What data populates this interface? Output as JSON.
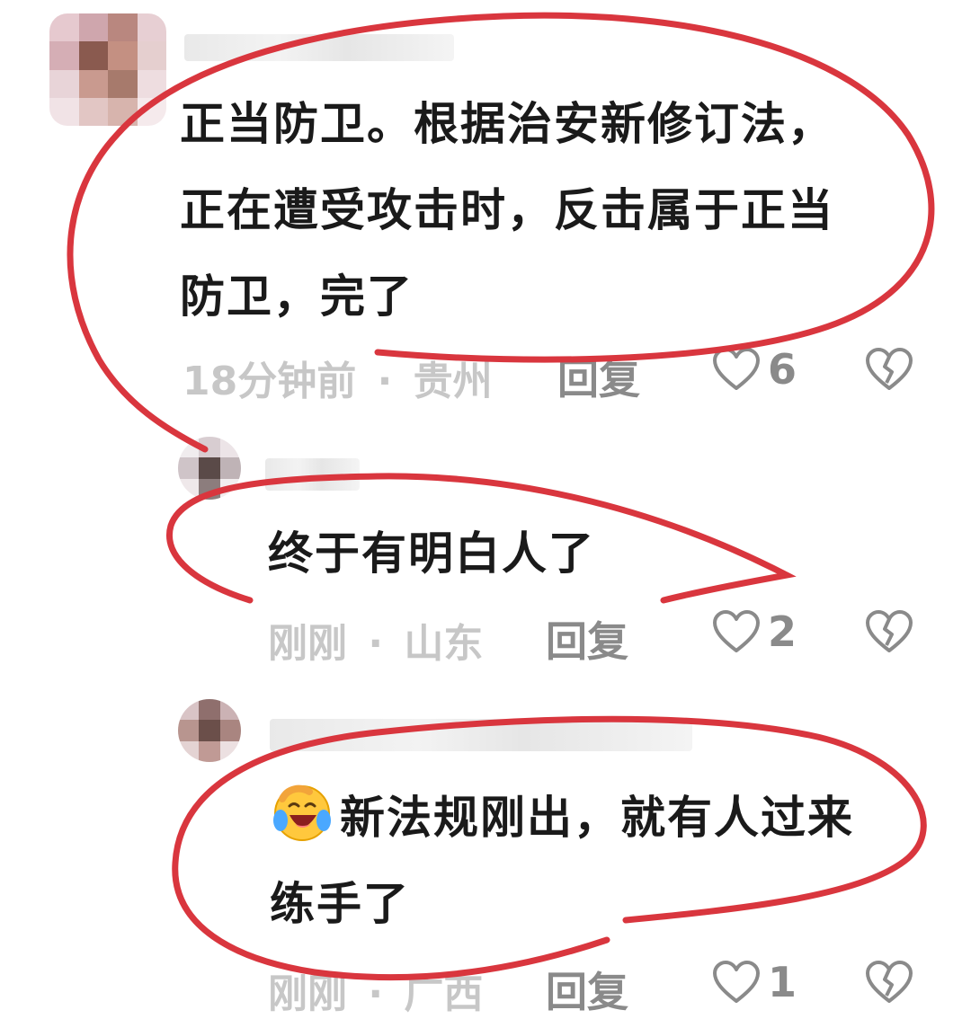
{
  "comments": [
    {
      "avatar_colors": [
        "#e6c9cf",
        "#cfa6ad",
        "#b9877f",
        "#e7cfd3",
        "#d5aeb5",
        "#8a5a4f",
        "#c49082",
        "#e5cfcf",
        "#e8d4d8",
        "#c99a8f",
        "#a77a6c",
        "#eedde0",
        "#f1e3e6",
        "#e2c6c4",
        "#d7b4ad",
        "#f5eaec"
      ],
      "lines": [
        "正当防卫。根据治安新修订法，",
        "正在遭受攻击时，反击属于正当",
        "防卫，完了"
      ],
      "time": "18分钟前",
      "separator": "·",
      "location": "贵州",
      "reply_label": "回复",
      "like_count": "6"
    },
    {
      "avatar_colors": [
        "#f0ecee",
        "#d8cdd1",
        "#ece4e7",
        "#cfc4c8",
        "#5a4a48",
        "#bfb3b6",
        "#efe8ea",
        "#8c7d7d",
        "#f2eeef"
      ],
      "lines": [
        "终于有明白人了"
      ],
      "time": "刚刚",
      "separator": "·",
      "location": "山东",
      "reply_label": "回复",
      "like_count": "2"
    },
    {
      "avatar_colors": [
        "#d9c4c6",
        "#8f6f6d",
        "#cbb2b4",
        "#b8958f",
        "#6b4f4a",
        "#a98580",
        "#e4d3d3",
        "#c09a95",
        "#ece0e1"
      ],
      "lines": [
        "新法规刚出，就有人过来",
        "练手了"
      ],
      "emoji": "crying-laughing-emoji",
      "time": "刚刚",
      "separator": "·",
      "location": "广西",
      "reply_label": "回复",
      "like_count": "1"
    }
  ],
  "colors": {
    "text": "#1a1a1a",
    "meta": "#c7c7c7",
    "action": "#8a8a8a",
    "annotation": "#d9363e"
  }
}
